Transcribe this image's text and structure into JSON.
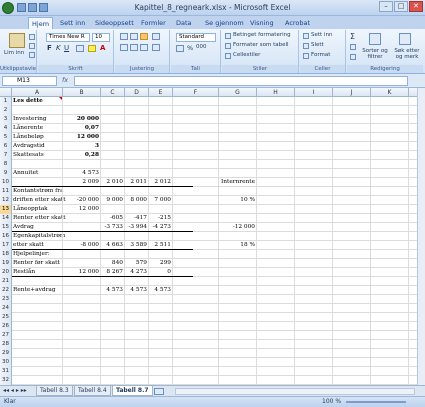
{
  "window": {
    "title": "Kapittel_8_regneark.xlsx - Microsoft Excel"
  },
  "tabs": [
    "Hjem",
    "Sett inn",
    "Sideoppsett",
    "Formler",
    "Data",
    "Se gjennom",
    "Visning",
    "Acrobat"
  ],
  "ribbon": {
    "paste_label": "Lim inn",
    "font_name": "Times New R",
    "font_size": "10",
    "number_format": "Standard",
    "styles": {
      "conditional": "Betinget formatering",
      "table": "Formater som tabell",
      "cell": "Cellestiler"
    },
    "cells": {
      "insert": "Sett inn",
      "delete": "Slett",
      "format": "Format"
    },
    "editing": {
      "sum": "Σ",
      "sort": "Sorter og filtrer",
      "find": "Søk etter og merk"
    },
    "groups": [
      "Utklippstavle",
      "Skrift",
      "Justering",
      "Tall",
      "Stiler",
      "Celler",
      "Redigering"
    ]
  },
  "formula_bar": {
    "name_box": "M13",
    "fx": "fx",
    "content": ""
  },
  "columns": [
    "A",
    "B",
    "C",
    "D",
    "E",
    "F",
    "G",
    "H",
    "I",
    "J",
    "K"
  ],
  "rows": [
    {
      "n": "1",
      "a": "Les dette",
      "bold_a": true
    },
    {
      "n": "2",
      "a": ""
    },
    {
      "n": "3",
      "a": "Investering",
      "b": "20 000",
      "bold_b": true
    },
    {
      "n": "4",
      "a": "Lånerente",
      "b": "0,07",
      "bold_b": true
    },
    {
      "n": "5",
      "a": "Lånebeløp",
      "b": "12 000",
      "bold_b": true
    },
    {
      "n": "6",
      "a": "Avdragstid",
      "b": "3",
      "bold_b": true
    },
    {
      "n": "7",
      "a": "Skattesats",
      "b": "0,28",
      "bold_b": true
    },
    {
      "n": "8",
      "a": ""
    },
    {
      "n": "9",
      "a": "Annuitet",
      "b": "4 573"
    },
    {
      "n": "10",
      "a": "",
      "b": "2 009",
      "c": "2 010",
      "d": "2 011",
      "e": "2 012",
      "g": "Internrente"
    },
    {
      "n": "11",
      "a": "Kontantstrøm fra"
    },
    {
      "n": "12",
      "a": "driften etter skatt",
      "b": "-20 000",
      "c": "9 000",
      "d": "8 000",
      "e": "7 000",
      "g": "10 %"
    },
    {
      "n": "13",
      "a": "Låneopptak",
      "b": "12 000"
    },
    {
      "n": "14",
      "a": "Renter etter skatt",
      "c": "-605",
      "d": "-417",
      "e": "-215"
    },
    {
      "n": "15",
      "a": "Avdrag",
      "c": "-3 733",
      "d": "-3 994",
      "e": "-4 273",
      "g": "-12 000"
    },
    {
      "n": "16",
      "a": "Egenkapitalstrøm"
    },
    {
      "n": "17",
      "a": "etter skatt",
      "b": "-8 000",
      "c": "4 663",
      "d": "3 589",
      "e": "2 511",
      "g": "18 %"
    },
    {
      "n": "18",
      "a": "Hjelpelinjer:"
    },
    {
      "n": "19",
      "a": "Renter før skatt",
      "c": "840",
      "d": "579",
      "e": "299"
    },
    {
      "n": "20",
      "a": "Restlån",
      "b": "12 000",
      "c": "8 267",
      "d": "4 273",
      "e": "0"
    },
    {
      "n": "21",
      "a": ""
    },
    {
      "n": "22",
      "a": "Rente+avdrag",
      "c": "4 573",
      "d": "4 573",
      "e": "4 573"
    },
    {
      "n": "23"
    },
    {
      "n": "24"
    },
    {
      "n": "25"
    },
    {
      "n": "26"
    },
    {
      "n": "27"
    },
    {
      "n": "28"
    },
    {
      "n": "29"
    },
    {
      "n": "30"
    },
    {
      "n": "31"
    },
    {
      "n": "32"
    }
  ],
  "sheet_tabs": [
    "Tabell 8.3",
    "Tabell 8.4",
    "Tabell 8.7"
  ],
  "active_sheet": "Tabell 8.7",
  "status": {
    "ready": "Klar",
    "zoom": "100 %"
  }
}
